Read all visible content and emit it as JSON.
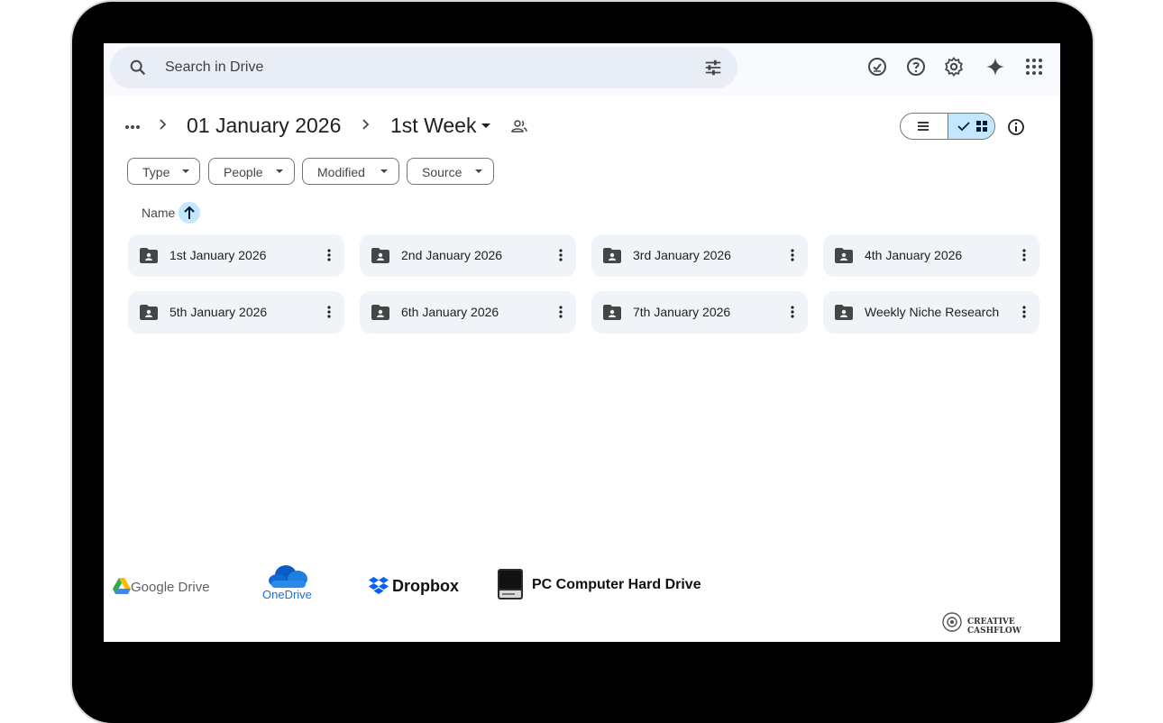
{
  "search": {
    "placeholder": "Search in Drive"
  },
  "top_icons": [
    "ready-for-offline-icon",
    "help-icon",
    "settings-icon",
    "gemini-icon",
    "apps-grid-icon"
  ],
  "breadcrumb": {
    "parent": "01 January 2026",
    "current": "1st Week"
  },
  "filters": [
    "Type",
    "People",
    "Modified",
    "Source"
  ],
  "sort": {
    "label": "Name"
  },
  "folders": [
    "1st January 2026",
    "2nd January 2026",
    "3rd January 2026",
    "4th January 2026",
    "5th January 2026",
    "6th January 2026",
    "7th January 2026",
    "Weekly Niche Research"
  ],
  "brands": {
    "google_drive": "Google Drive",
    "onedrive": "OneDrive",
    "dropbox": "Dropbox",
    "pc": "PC Computer Hard Drive",
    "watermark": "CREATIVE CASHFLOW"
  },
  "colors": {
    "accent": "#c2e7ff",
    "folder_bg": "#f0f4f9",
    "search_bg": "#e9eef6"
  }
}
